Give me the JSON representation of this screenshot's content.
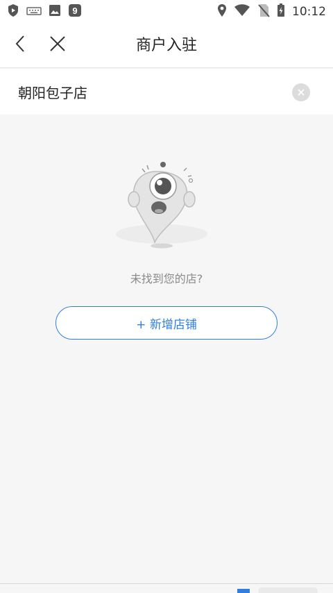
{
  "status_bar": {
    "time": "10:12",
    "icons_left": [
      "shield-play-icon",
      "keyboard-icon",
      "image-icon",
      "app-9-icon"
    ],
    "icons_right": [
      "location-icon",
      "wifi-icon",
      "no-sim-icon",
      "battery-charging-icon"
    ]
  },
  "nav": {
    "title": "商户入驻",
    "back_icon": "chevron-left-icon",
    "close_icon": "close-icon"
  },
  "search": {
    "value": "朝阳包子店",
    "clear_icon": "clear-circle-icon"
  },
  "empty_state": {
    "illustration": "sad-ghost-illustration",
    "message": "未找到您的店?"
  },
  "add_store": {
    "label": "+ 新增店铺"
  },
  "colors": {
    "accent": "#2f7fe0",
    "background": "#f6f6f6",
    "text_muted": "#8a8a8a"
  }
}
